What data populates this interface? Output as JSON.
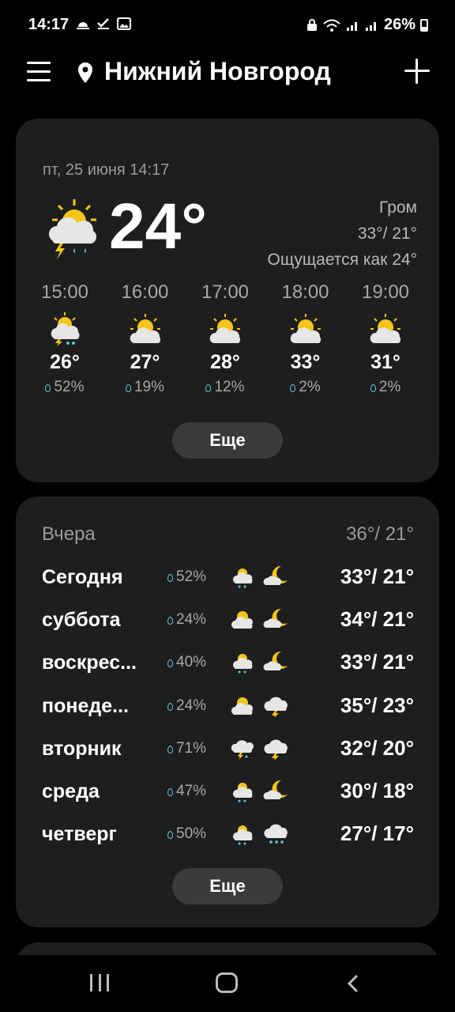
{
  "status_bar": {
    "time": "14:17",
    "battery": "26%"
  },
  "header": {
    "city": "Нижний Новгород"
  },
  "current": {
    "datetime": "пт, 25 июня 14:17",
    "temp": "24°",
    "condition": "Гром",
    "high_low": "33°/ 21°",
    "feels_like": "Ощущается как 24°"
  },
  "hourly": [
    {
      "time": "15:00",
      "temp": "26°",
      "precip": "52%",
      "icon": "thunder-partly-cloudy-icon"
    },
    {
      "time": "16:00",
      "temp": "27°",
      "precip": "19%",
      "icon": "partly-cloudy-icon"
    },
    {
      "time": "17:00",
      "temp": "28°",
      "precip": "12%",
      "icon": "partly-cloudy-icon"
    },
    {
      "time": "18:00",
      "temp": "33°",
      "precip": "2%",
      "icon": "partly-cloudy-icon"
    },
    {
      "time": "19:00",
      "temp": "31°",
      "precip": "2%",
      "icon": "partly-cloudy-icon"
    }
  ],
  "more_button_1": "Еще",
  "daily": {
    "yesterday_label": "Вчера",
    "yesterday_temp": "36°/ 21°",
    "days": [
      {
        "name": "Сегодня",
        "precip": "52%",
        "temp": "33°/ 21°",
        "day_icon": "sun-cloud-rain-icon",
        "night_icon": "moon-cloud-icon"
      },
      {
        "name": "суббота",
        "precip": "24%",
        "temp": "34°/ 21°",
        "day_icon": "partly-cloudy-icon",
        "night_icon": "moon-cloud-icon"
      },
      {
        "name": "воскрес...",
        "precip": "40%",
        "temp": "33°/ 21°",
        "day_icon": "sun-cloud-rain-icon",
        "night_icon": "moon-cloud-icon"
      },
      {
        "name": "понеде...",
        "precip": "24%",
        "temp": "35°/ 23°",
        "day_icon": "partly-cloudy-icon",
        "night_icon": "thunder-cloud-icon"
      },
      {
        "name": "вторник",
        "precip": "71%",
        "temp": "32°/ 20°",
        "day_icon": "thunder-cloud-rain-icon",
        "night_icon": "thunder-cloud-icon"
      },
      {
        "name": "среда",
        "precip": "47%",
        "temp": "30°/ 18°",
        "day_icon": "sun-cloud-rain-icon",
        "night_icon": "moon-cloud-icon"
      },
      {
        "name": "четверг",
        "precip": "50%",
        "temp": "27°/ 17°",
        "day_icon": "sun-cloud-rain-icon",
        "night_icon": "cloud-rain-icon"
      }
    ]
  },
  "more_button_2": "Еще"
}
